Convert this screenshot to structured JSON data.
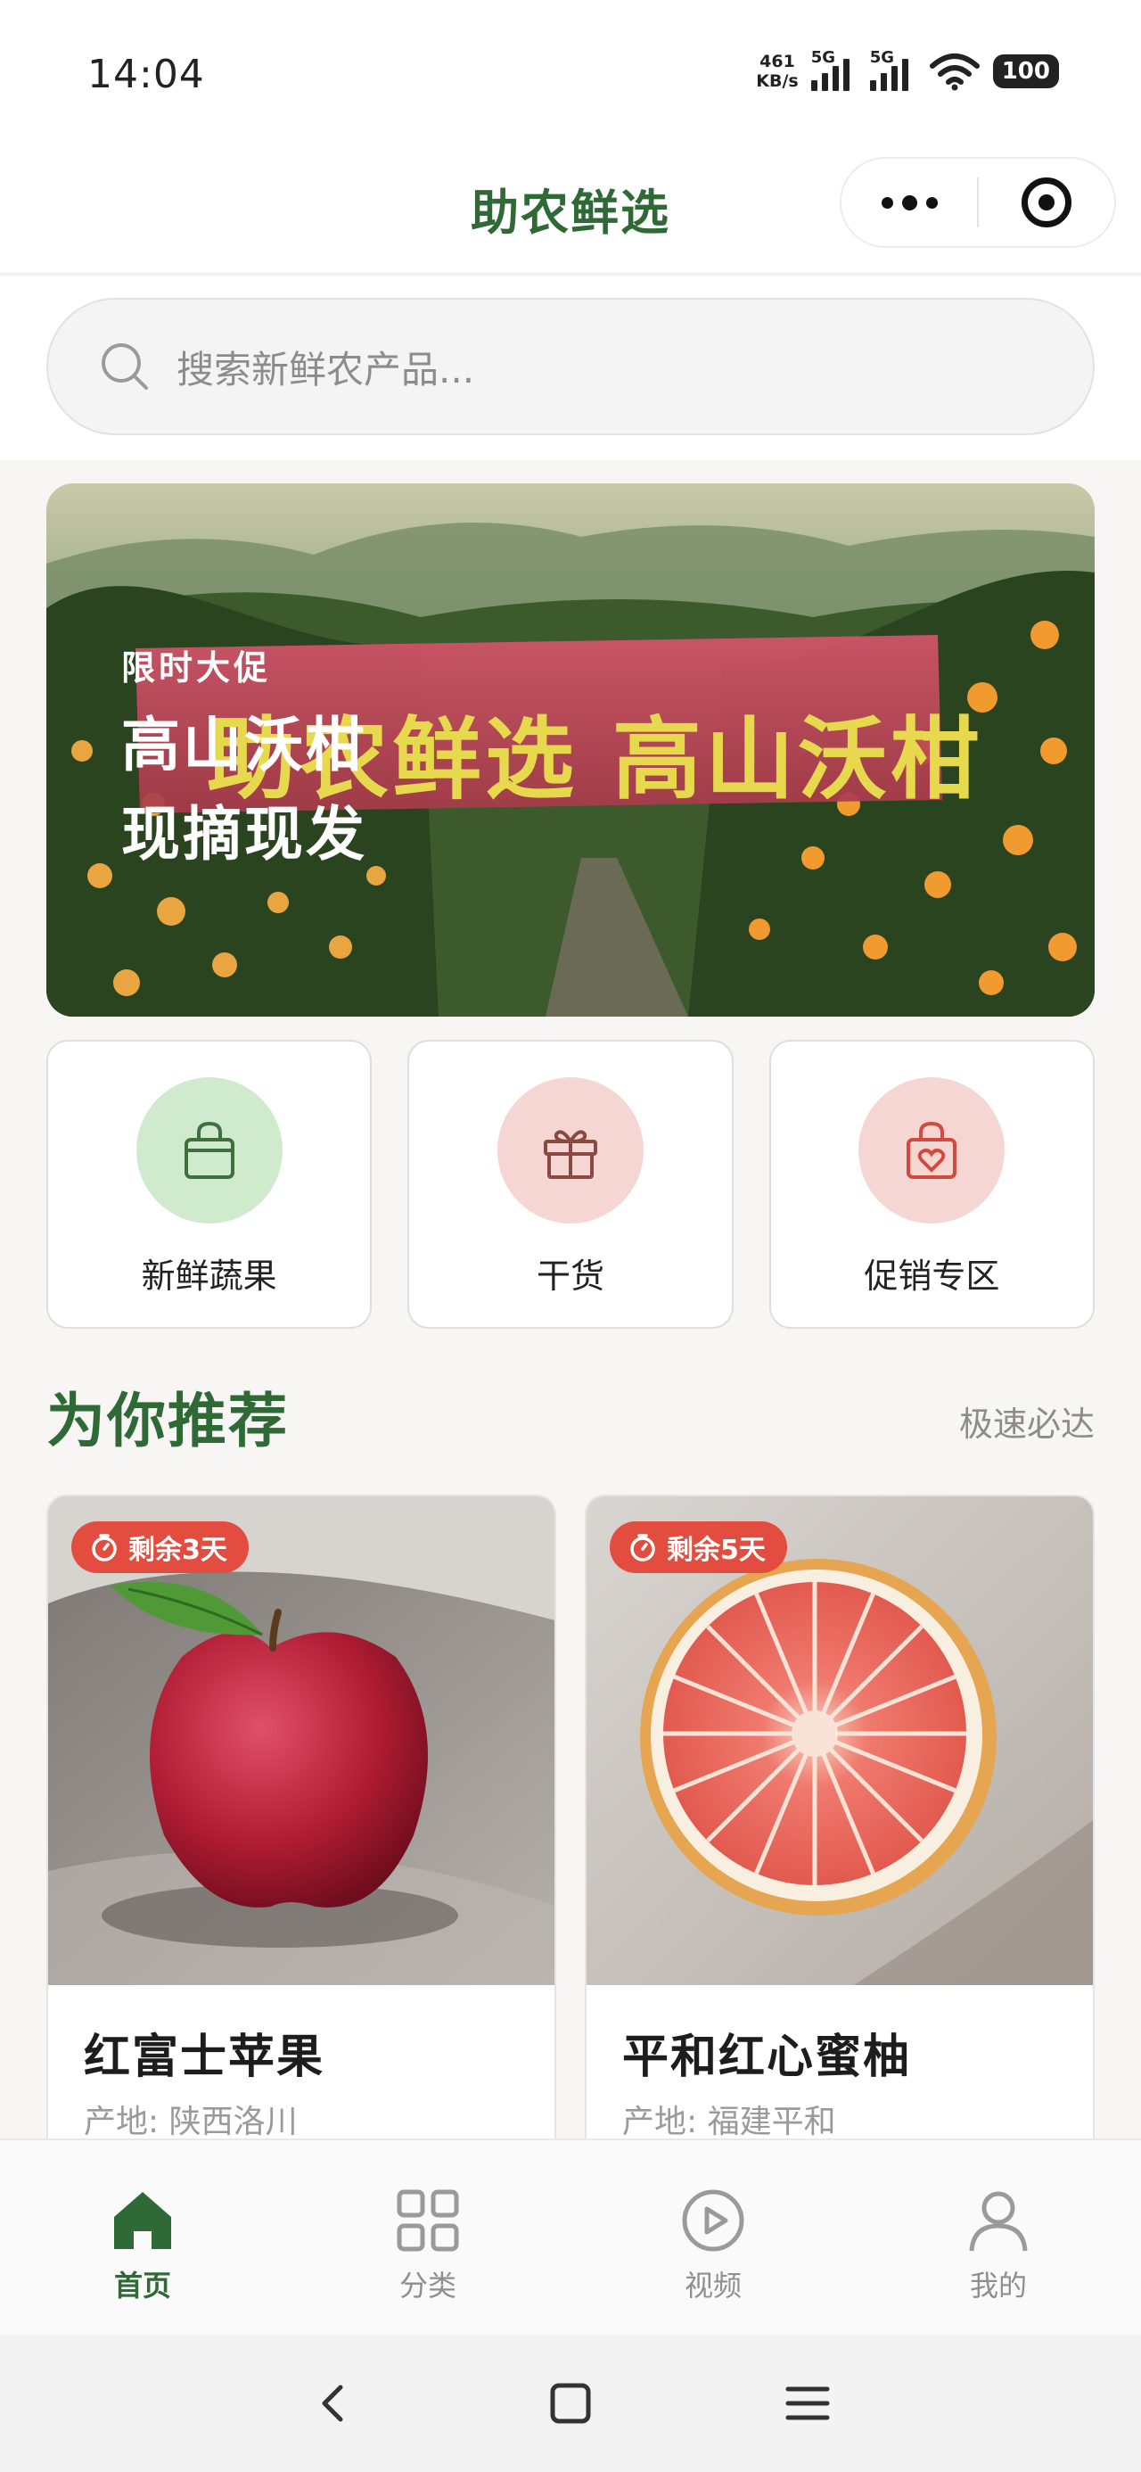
{
  "status_bar": {
    "time": "14:04",
    "net_speed_value": "461",
    "net_speed_unit": "KB/s",
    "signal1": "5G",
    "signal2": "5G",
    "battery": "100"
  },
  "header": {
    "title": "助农鲜选",
    "title_color": "#2f6a36",
    "more_icon": "more-dots-icon",
    "target_icon": "target-icon"
  },
  "search": {
    "placeholder": "搜索新鲜农产品..."
  },
  "banner": {
    "tag": "限时大促",
    "line1": "高山沃柑",
    "line2": "现摘现发",
    "cloth_text": "助农鲜选 高山沃柑"
  },
  "categories": [
    {
      "label": "新鲜蔬果",
      "icon": "shopping-bag-icon",
      "bg": "#cfeacc"
    },
    {
      "label": "干货",
      "icon": "gift-icon",
      "bg": "#f6d6d2"
    },
    {
      "label": "促销专区",
      "icon": "heart-bag-icon",
      "bg": "#f6d6d2"
    }
  ],
  "recommend": {
    "title": "为你推荐",
    "more": "极速必达"
  },
  "products": [
    {
      "badge": "剩余3天",
      "name": "红富士苹果",
      "origin": "产地: 陕西洛川"
    },
    {
      "badge": "剩余5天",
      "name": "平和红心蜜柚",
      "origin": "产地: 福建平和"
    }
  ],
  "tabbar": {
    "items": [
      {
        "label": "首页",
        "icon": "home-icon",
        "active": true
      },
      {
        "label": "分类",
        "icon": "grid-icon",
        "active": false
      },
      {
        "label": "视频",
        "icon": "play-circle-icon",
        "active": false
      },
      {
        "label": "我的",
        "icon": "user-icon",
        "active": false
      }
    ]
  },
  "system_nav": {
    "icons": [
      "back-icon",
      "home-square-icon",
      "menu-icon"
    ]
  },
  "colors": {
    "accent": "#2f6a36",
    "badge": "#e24d3f"
  }
}
